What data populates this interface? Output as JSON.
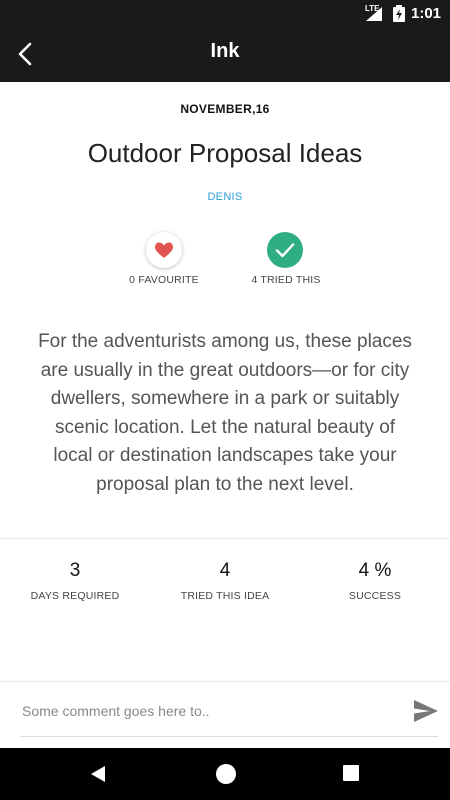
{
  "status_bar": {
    "network": "LTE",
    "time": "1:01"
  },
  "app_bar": {
    "title": "Ink",
    "back_icon": "arrow-back-icon"
  },
  "post": {
    "date": "NOVEMBER,16",
    "title": "Outdoor Proposal Ideas",
    "author": "DENIS",
    "favourite_label": "0 FAVOURITE",
    "tried_label": "4  TRIED THIS",
    "favourite_icon": "heart-icon",
    "tried_icon": "check-icon",
    "description": "For the adventurists among us, these places are usually in the great outdoors—or for city dwellers, somewhere in a park or suitably scenic location. Let the natural beauty of local or destination landscapes take your proposal plan to the next level."
  },
  "stats": [
    {
      "value": "3",
      "label": "DAYS REQUIRED"
    },
    {
      "value": "4",
      "label": "TRIED THIS IDEA"
    },
    {
      "value": "4 %",
      "label": "SUCCESS"
    }
  ],
  "comment": {
    "placeholder": "Some comment goes here to..",
    "value": "",
    "send_icon": "send-icon"
  },
  "colors": {
    "bar": "#1a1a1a",
    "accent_blue": "#2a9fd6",
    "heart_red": "#e0574f",
    "check_green": "#2fae84"
  }
}
